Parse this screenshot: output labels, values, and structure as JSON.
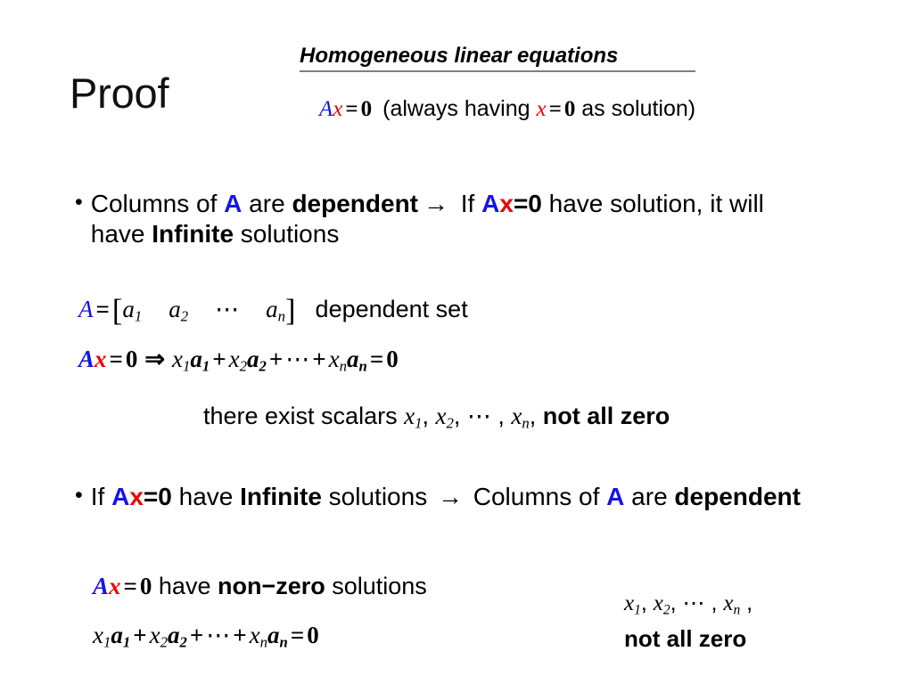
{
  "slide": {
    "proof_title": "Proof",
    "topic_heading": "Homogeneous linear equations",
    "underline_color": "#7f7f7f",
    "background_color": "#ffffff"
  },
  "colors": {
    "matrix_A": "#1414e6",
    "vector_x": "#ee0000",
    "text": "#000000"
  },
  "header_equation": {
    "matrix": "A",
    "vector": "x",
    "equals": "=",
    "zero": "0",
    "note_open": "(always having ",
    "note_var": "x",
    "note_equals": "=",
    "note_zero": "0",
    "note_close": " as solution)"
  },
  "bullets": [
    {
      "marker": "•",
      "part1": "Columns of ",
      "A": "A",
      "part2": " are ",
      "dependent": "dependent",
      "arrow": "→",
      "part3": " If ",
      "Ax_A": "A",
      "Ax_x": "x",
      "Ax_eq0": "=0",
      "part4": " have solution, it will have ",
      "infinite": "Infinite",
      "part5": " solutions"
    },
    {
      "marker": "•",
      "part1": "If ",
      "Ax_A": "A",
      "Ax_x": "x",
      "Ax_eq0": "=0",
      "part2": " have ",
      "infinite": "Infinite",
      "part3": " solutions ",
      "arrow": "→",
      "part4": " Columns of ",
      "A": "A",
      "part5": " are ",
      "dependent": "dependent"
    }
  ],
  "equations": {
    "matrix_def": {
      "A": "A",
      "equals": "=",
      "bracket_open": "[",
      "a1": "a",
      "a1_sub": "1",
      "a2": "a",
      "a2_sub": "2",
      "dots": "⋯",
      "an": "a",
      "an_sub": "n",
      "bracket_close": "]",
      "label": "dependent set"
    },
    "expansion": {
      "A": "A",
      "x": "x",
      "equals": "=",
      "zero": "0",
      "implies": "⇒",
      "x1": "x",
      "x1_sub": "1",
      "a1": "a",
      "a1_sub": "1",
      "plus1": "+",
      "x2": "x",
      "x2_sub": "2",
      "a2": "a",
      "a2_sub": "2",
      "plus2": "+",
      "dots": "⋯",
      "plus3": "+",
      "xn": "x",
      "xn_sub": "n",
      "an": "a",
      "an_sub": "n",
      "equals2": "=",
      "zero2": "0"
    },
    "scalars_line": {
      "lead": "there exist scalars ",
      "x1": "x",
      "x1_sub": "1",
      "comma1": ", ",
      "x2": "x",
      "x2_sub": "2",
      "comma2": ", ",
      "dots": "⋯",
      "comma3": " , ",
      "xn": "x",
      "xn_sub": "n",
      "comma4": ", ",
      "emphasis": "not all zero"
    }
  },
  "bottom": {
    "left_line1": {
      "A": "A",
      "x": "x",
      "equals": "=",
      "zero": "0",
      "have": " have ",
      "non_zero": "non−zero",
      "solutions": " solutions"
    },
    "left_line2": {
      "x1": "x",
      "x1_sub": "1",
      "a1": "a",
      "a1_sub": "1",
      "plus1": "+",
      "x2": "x",
      "x2_sub": "2",
      "a2": "a",
      "a2_sub": "2",
      "plus2": "+",
      "dots": "⋯",
      "plus3": "+",
      "xn": "x",
      "xn_sub": "n",
      "an": "a",
      "an_sub": "n",
      "equals": "=",
      "zero": "0"
    },
    "right_line1": {
      "x1": "x",
      "x1_sub": "1",
      "comma1": ", ",
      "x2": "x",
      "x2_sub": "2",
      "comma2": ", ",
      "dots": "⋯",
      "comma3": " , ",
      "xn": "x",
      "xn_sub": "n",
      "comma4": " ,"
    },
    "right_line2": "not all zero"
  }
}
